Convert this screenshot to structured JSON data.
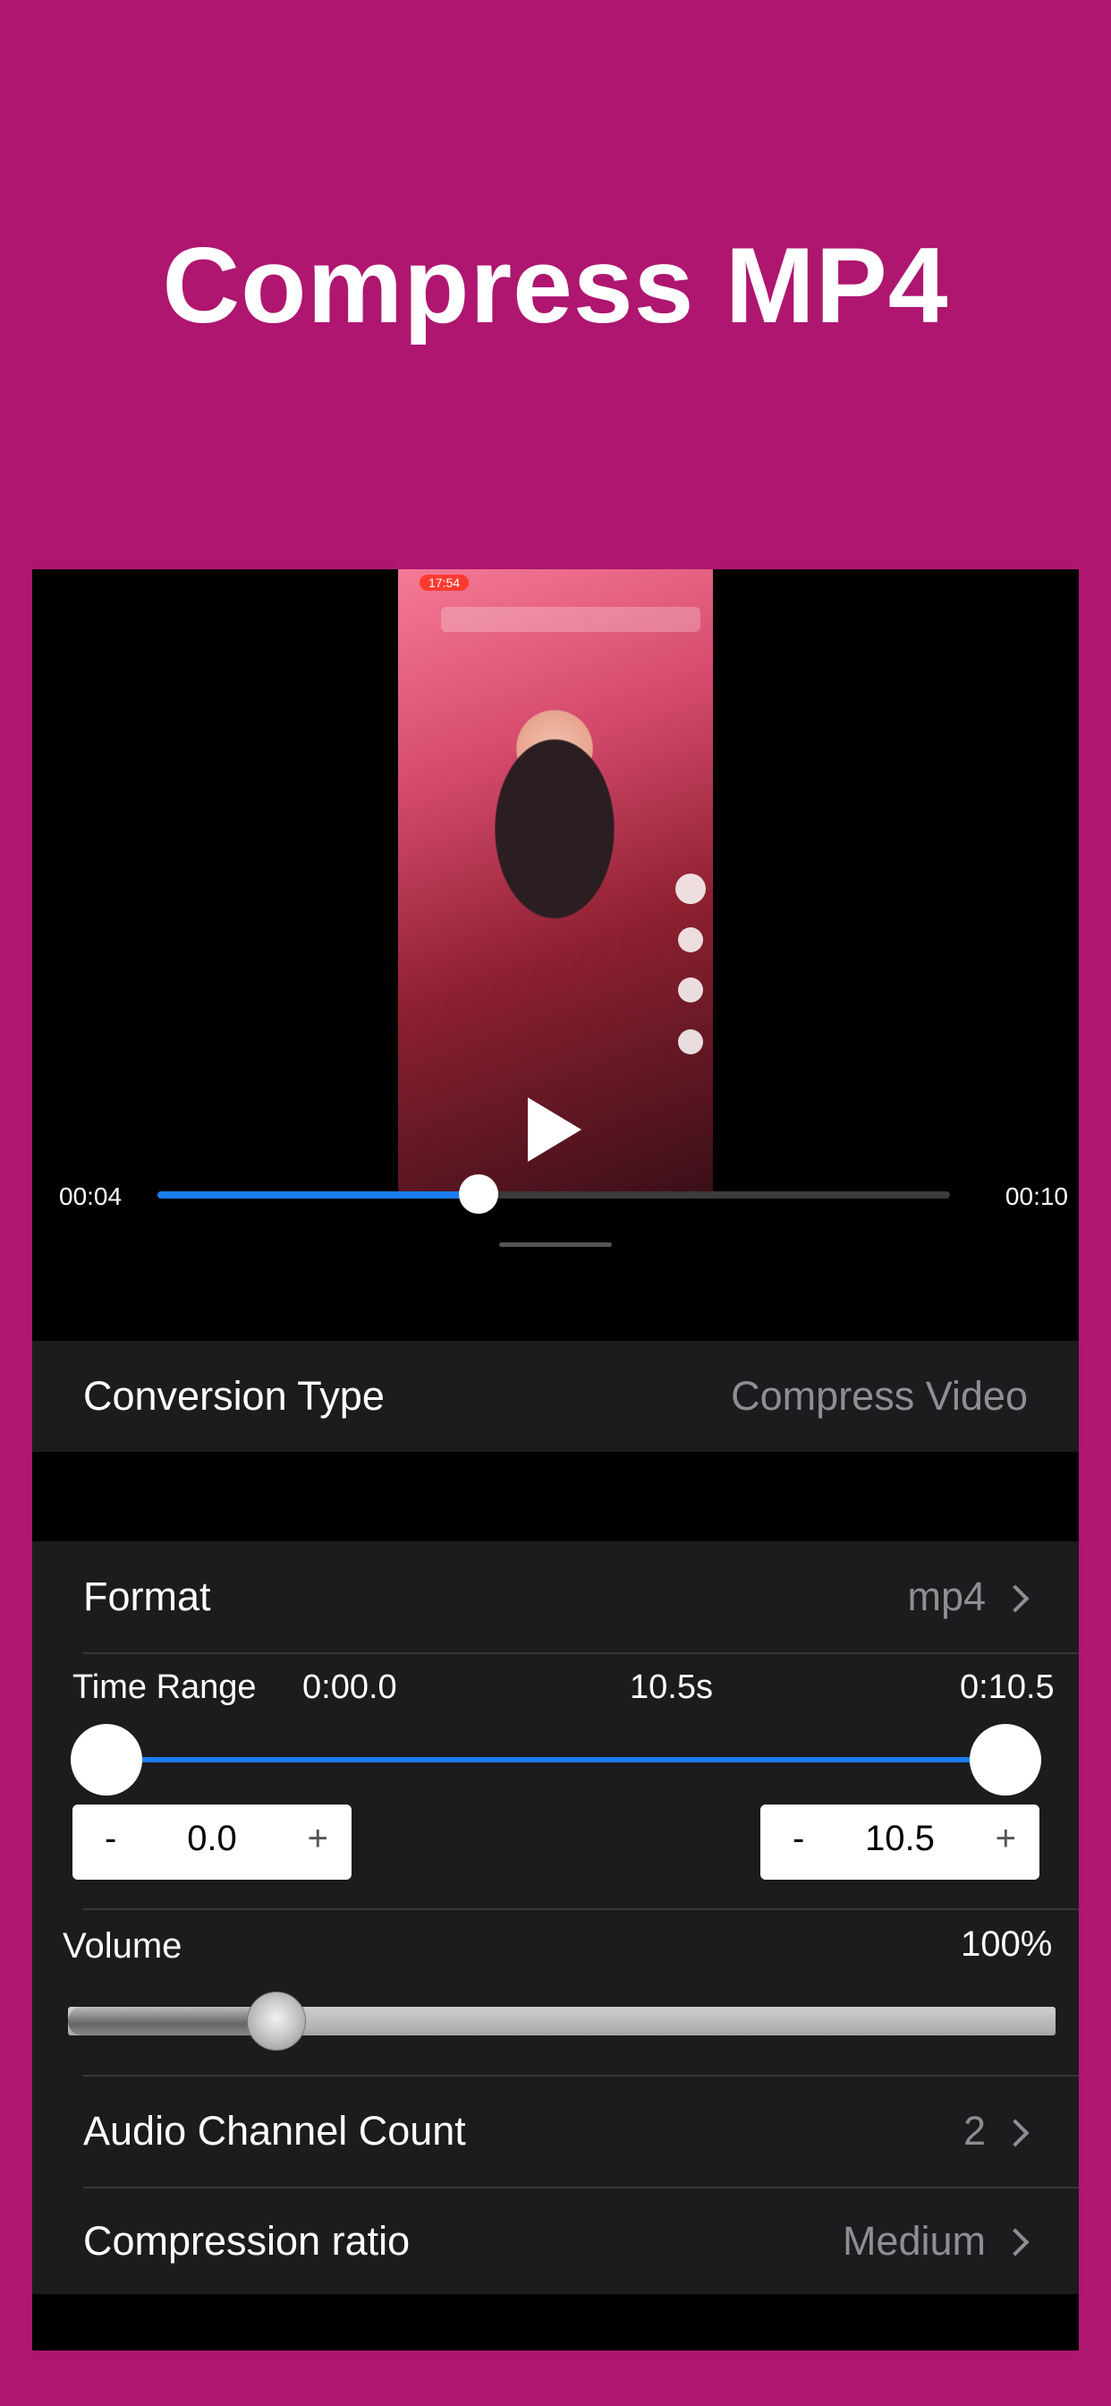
{
  "header": {
    "title": "Compress MP4"
  },
  "player": {
    "current_time": "00:04",
    "duration": "00:10",
    "progress": 0.405,
    "thumb_status_time": "17:54"
  },
  "conversion_type": {
    "label": "Conversion Type",
    "value": "Compress Video"
  },
  "format": {
    "label": "Format",
    "value": "mp4"
  },
  "time_range": {
    "label": "Time Range",
    "start_label": "0:00.0",
    "duration_label": "10.5s",
    "end_label": "0:10.5",
    "start_value": "0.0",
    "end_value": "10.5",
    "minus": "-",
    "plus": "+"
  },
  "volume": {
    "label": "Volume",
    "value": "100%",
    "level": 0.21
  },
  "audio_channel": {
    "label": "Audio Channel Count",
    "value": "2"
  },
  "compression": {
    "label": "Compression ratio",
    "value": "Medium"
  },
  "colors": {
    "background": "#ae1670",
    "accent": "#1a7df0",
    "row_background": "#1c1c1e",
    "secondary_text": "#8e8e93"
  },
  "icons": [
    "play-icon",
    "chevron-right-icon"
  ]
}
